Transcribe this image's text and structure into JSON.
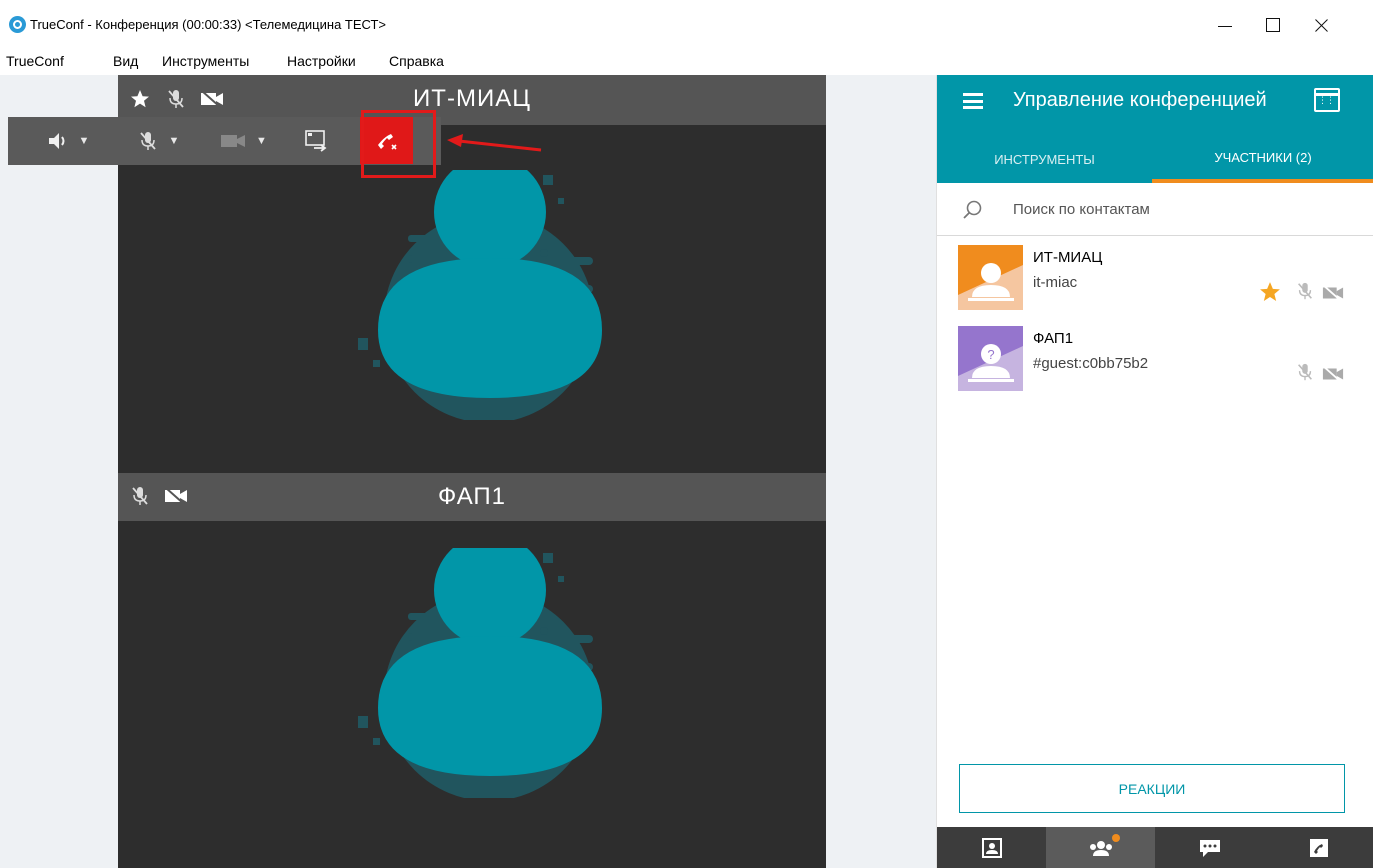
{
  "window": {
    "title": "TrueConf - Конференция (00:00:33) <Телемедицина ТЕСТ>"
  },
  "menu": [
    "TrueConf",
    "Вид",
    "Инструменты",
    "Настройки",
    "Справка"
  ],
  "tiles": [
    {
      "name": "ИТ-МИАЦ",
      "icons": [
        "star-icon",
        "mic-off-icon",
        "camera-off-icon"
      ]
    },
    {
      "name": "ФАП1",
      "icons": [
        "mic-off-icon",
        "camera-off-icon"
      ]
    }
  ],
  "toolbar": {
    "buttons": [
      "speaker-icon",
      "mic-off-icon",
      "camera-icon",
      "share-screen-icon",
      "hangup-icon"
    ]
  },
  "panel": {
    "title": "Управление конференцией",
    "tabs": [
      "ИНСТРУМЕНТЫ",
      "УЧАСТНИКИ (2)"
    ],
    "active_tab": "УЧАСТНИКИ (2)",
    "search_placeholder": "Поиск по контактам",
    "participants": [
      {
        "name": "ИТ-МИАЦ",
        "id": "it-miac",
        "owner": true,
        "avatar_color": "#f08c1e"
      },
      {
        "name": "ФАП1",
        "id": "#guest:c0bb75b2",
        "owner": false,
        "avatar_color": "#9575cd"
      }
    ],
    "reactions_label": "РЕАКЦИИ",
    "bottom_nav": [
      "address-book-icon",
      "participants-icon",
      "chat-icon",
      "hangup-icon"
    ]
  },
  "colors": {
    "accent": "#0196a8",
    "tab_indicator": "#f08c1e",
    "hangup": "#e01818",
    "avatar_teal": "#0196a8"
  }
}
